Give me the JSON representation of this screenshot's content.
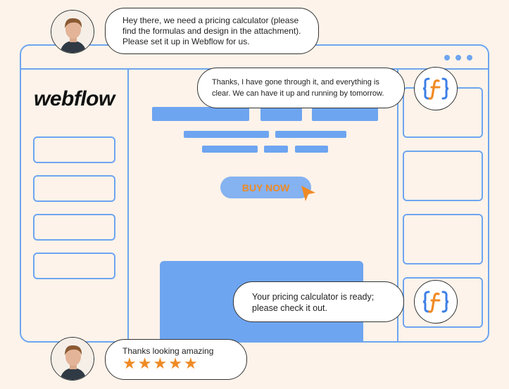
{
  "colors": {
    "accent": "#6ea5f0",
    "orange": "#f08a24",
    "background": "#fdf3ea"
  },
  "brand": {
    "logo_text": "webflow"
  },
  "cta": {
    "label": "BUY NOW"
  },
  "chat": {
    "client_request": "Hey there, we need a pricing calculator (please find the formulas and design in the attachment). Please set it up in Webflow for us.",
    "agency_reply": "Thanks, I have gone through it, and everything is clear. We can have it up and running by tomorrow.",
    "agency_done": "Your pricing calculator is ready; please check it out.",
    "client_feedback": "Thanks looking amazing",
    "rating": 5
  },
  "icons": {
    "agency_badge": "curly-brace-f-icon",
    "cursor": "cursor-arrow-icon",
    "star": "star-icon",
    "avatar": "user-avatar"
  }
}
